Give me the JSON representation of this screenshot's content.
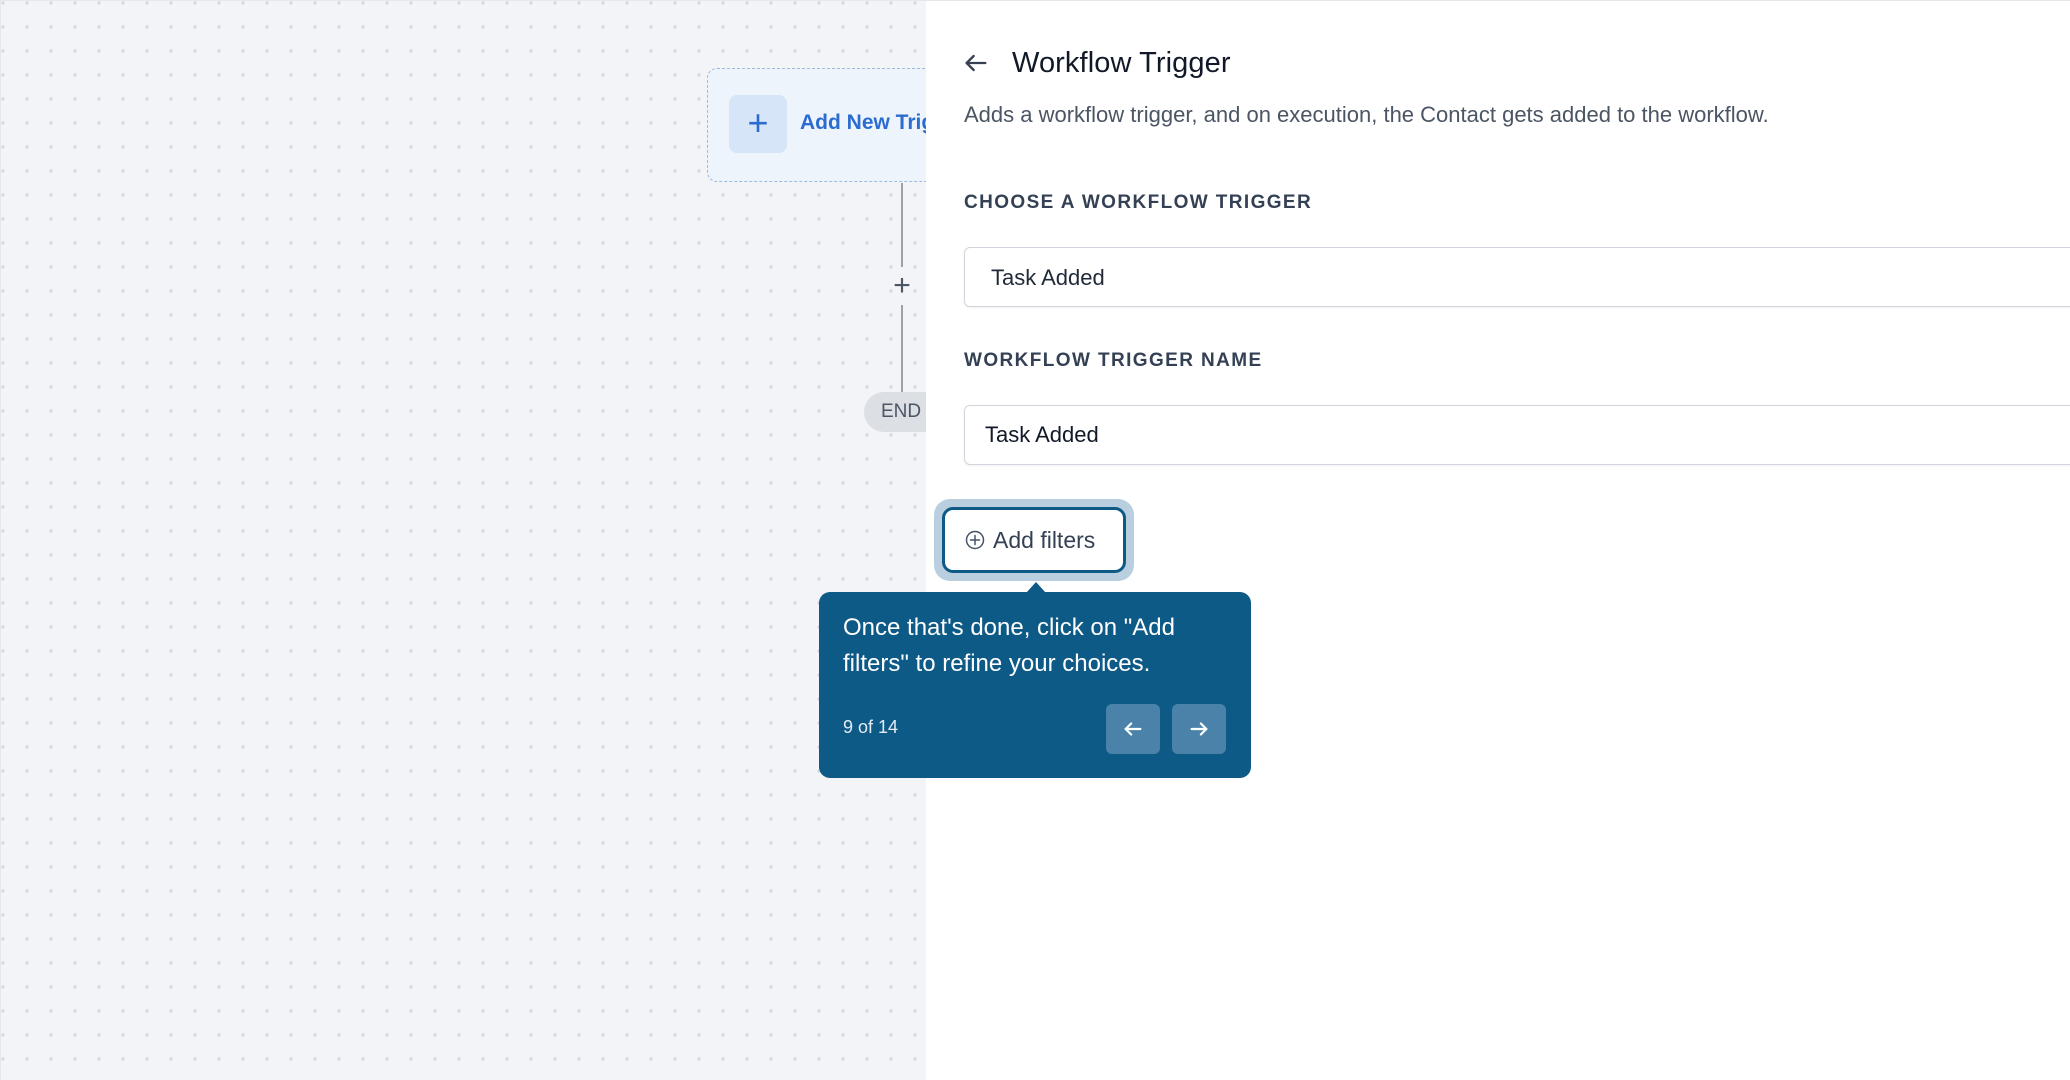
{
  "canvas": {
    "trigger_card_label": "Add New Trig",
    "add_node_symbol": "+",
    "end_label": "END"
  },
  "panel": {
    "title": "Workflow Trigger",
    "description": "Adds a workflow trigger, and on execution, the Contact gets added to the workflow.",
    "choose_trigger_label": "CHOOSE A WORKFLOW TRIGGER",
    "choose_trigger_value": "Task Added",
    "trigger_name_label": "WORKFLOW TRIGGER NAME",
    "trigger_name_value": "Task Added",
    "add_filters_label": "Add filters"
  },
  "tooltip": {
    "text": "Once that's done, click on \"Add filters\" to refine your choices.",
    "step": "9 of 14"
  },
  "colors": {
    "canvas_bg": "#f2f4f7",
    "accent_blue": "#2b6cd1",
    "tooltip_bg": "#0e5a87"
  }
}
